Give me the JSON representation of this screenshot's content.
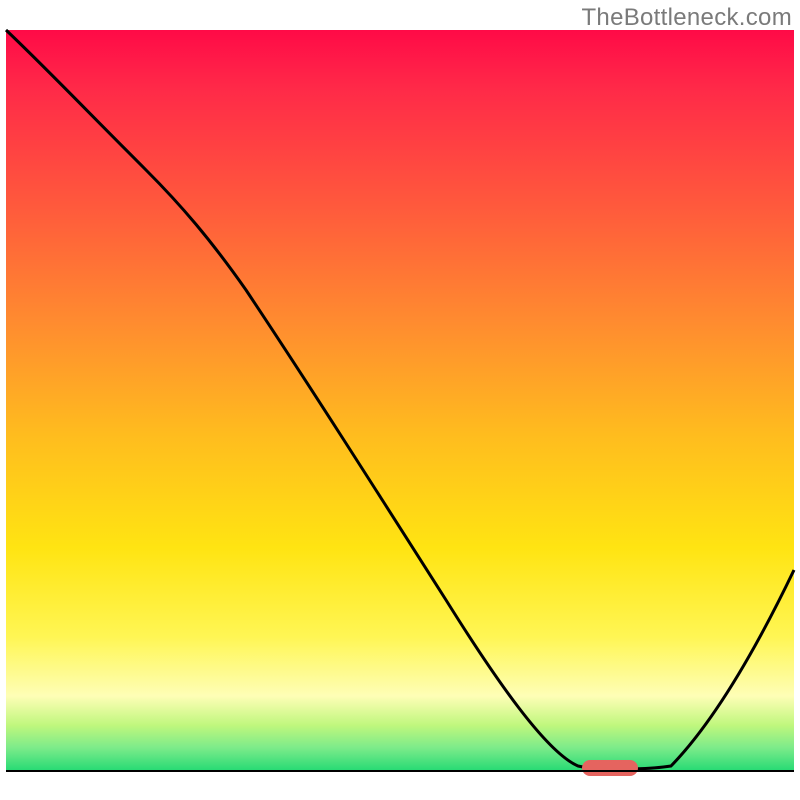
{
  "watermark": "TheBottleneck.com",
  "chart_data": {
    "type": "line",
    "title": "",
    "xlabel": "",
    "ylabel": "",
    "xlim": [
      0,
      100
    ],
    "ylim": [
      0,
      100
    ],
    "x": [
      0,
      10,
      20,
      30,
      40,
      50,
      60,
      68,
      74,
      78,
      85,
      92,
      100
    ],
    "values": [
      100,
      92,
      83,
      71,
      57,
      43,
      28,
      12,
      2,
      0,
      0,
      10,
      28
    ],
    "annotation": "Curve descends from upper-left, flattens at the baseline around x≈74–85, then rises toward the right edge.",
    "marker": {
      "x": 75,
      "y": 0,
      "color": "#e5645f"
    },
    "gradient_stops": [
      {
        "pct": 0,
        "color": "#ff0a47"
      },
      {
        "pct": 8,
        "color": "#ff2a48"
      },
      {
        "pct": 24,
        "color": "#ff5a3c"
      },
      {
        "pct": 40,
        "color": "#ff8d2f"
      },
      {
        "pct": 55,
        "color": "#ffbd1e"
      },
      {
        "pct": 70,
        "color": "#ffe412"
      },
      {
        "pct": 82,
        "color": "#fff654"
      },
      {
        "pct": 90,
        "color": "#fefeb6"
      },
      {
        "pct": 94,
        "color": "#bff77d"
      },
      {
        "pct": 97,
        "color": "#7ceb8a"
      },
      {
        "pct": 100,
        "color": "#29db75"
      }
    ]
  }
}
